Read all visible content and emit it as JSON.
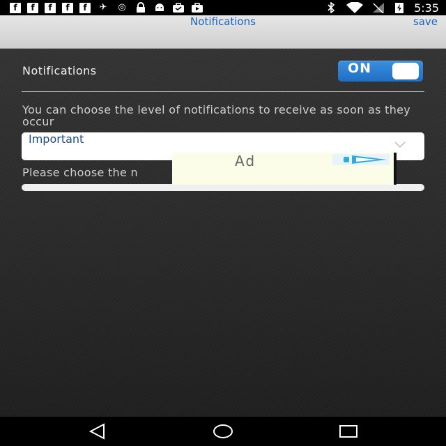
{
  "status_bar": {
    "notification_icons": [
      "facebook-icon",
      "facebook-icon",
      "facebook-icon",
      "facebook-icon",
      "facebook-icon"
    ],
    "other_icons": [
      "satellite-icon",
      "alarm-icon",
      "lock-icon",
      "android-icon",
      "shopping-bag-icon",
      "video-bag-icon"
    ],
    "time": "5:35"
  },
  "header": {
    "title": "Notifications",
    "save_label": "save"
  },
  "settings": {
    "notifications_label": "Notifications",
    "toggle_state": "ON",
    "description": "You can choose the level of notifications to receive as soon as they occur",
    "level_select": {
      "selected": "Important"
    },
    "please_text": "Please choose the n"
  },
  "ad": {
    "label": "Ad"
  },
  "colors": {
    "accent": "#1a62b8",
    "toggle": "#2a7fd6"
  }
}
